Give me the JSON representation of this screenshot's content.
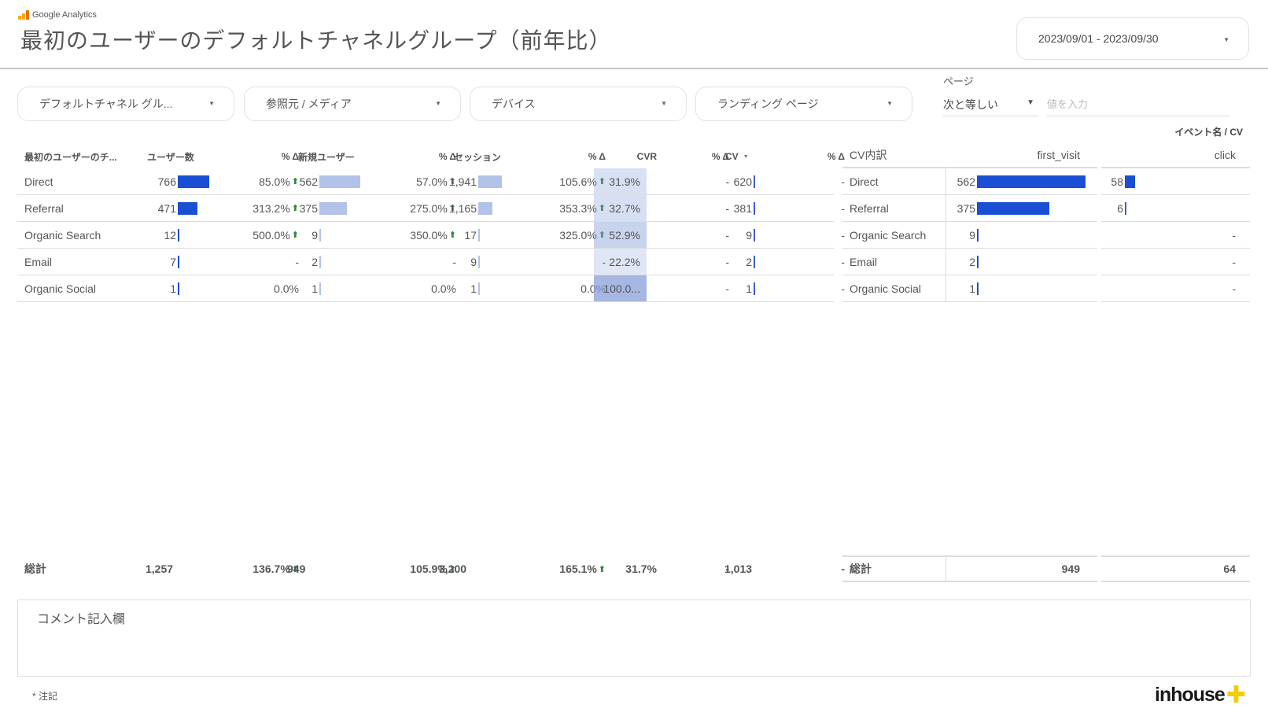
{
  "header": {
    "brand": "Google Analytics",
    "title": "最初のユーザーのデフォルトチャネルグループ（前年比）",
    "date_range": "2023/09/01 - 2023/09/30"
  },
  "filters": [
    {
      "label": "デフォルトチャネル グル..."
    },
    {
      "label": "参照元 / メディア"
    },
    {
      "label": "デバイス"
    },
    {
      "label": "ランディング ページ"
    }
  ],
  "page_filter": {
    "label": "ページ",
    "operator": "次と等しい",
    "placeholder": "値を入力",
    "value": ""
  },
  "colors": {
    "bar_dark": "#1a4fd4",
    "bar_light": "#b3c2e8",
    "up_arrow": "#2e8b3d",
    "brand_plus": "#f5cc00"
  },
  "main_table": {
    "headers": [
      "最初のユーザーのチ...",
      "ユーザー数",
      "% Δ",
      "新規ユーザー",
      "% Δ",
      "セッション",
      "% Δ",
      "CVR",
      "% Δ",
      "CV",
      "% Δ"
    ],
    "rows": [
      {
        "channel": "Direct",
        "users": "766",
        "users_bar": 1.0,
        "users_delta": "85.0%",
        "users_up": true,
        "new_users": "562",
        "new_users_bar": 1.0,
        "new_users_delta": "57.0%",
        "new_users_up": true,
        "sessions": "1,941",
        "sessions_bar": 1.0,
        "sessions_delta": "105.6%",
        "sessions_up": true,
        "cvr": "31.9%",
        "cvr_value": 0.319,
        "cvr_delta": "-",
        "cv": "620",
        "cv_delta": "-"
      },
      {
        "channel": "Referral",
        "users": "471",
        "users_bar": 0.615,
        "users_delta": "313.2%",
        "users_up": true,
        "new_users": "375",
        "new_users_bar": 0.667,
        "new_users_delta": "275.0%",
        "new_users_up": true,
        "sessions": "1,165",
        "sessions_bar": 0.6,
        "sessions_delta": "353.3%",
        "sessions_up": true,
        "cvr": "32.7%",
        "cvr_value": 0.327,
        "cvr_delta": "-",
        "cv": "381",
        "cv_delta": "-"
      },
      {
        "channel": "Organic Search",
        "users": "12",
        "users_bar": 0.016,
        "users_delta": "500.0%",
        "users_up": true,
        "new_users": "9",
        "new_users_bar": 0.016,
        "new_users_delta": "350.0%",
        "new_users_up": true,
        "sessions": "17",
        "sessions_bar": 0.009,
        "sessions_delta": "325.0%",
        "sessions_up": true,
        "cvr": "52.9%",
        "cvr_value": 0.529,
        "cvr_delta": "-",
        "cv": "9",
        "cv_delta": "-"
      },
      {
        "channel": "Email",
        "users": "7",
        "users_bar": 0.009,
        "users_delta": "-",
        "users_up": false,
        "new_users": "2",
        "new_users_bar": 0.004,
        "new_users_delta": "-",
        "new_users_up": false,
        "sessions": "9",
        "sessions_bar": 0.005,
        "sessions_delta": "-",
        "sessions_up": false,
        "cvr": "22.2%",
        "cvr_value": 0.222,
        "cvr_delta": "-",
        "cv": "2",
        "cv_delta": "-"
      },
      {
        "channel": "Organic Social",
        "users": "1",
        "users_bar": 0.001,
        "users_delta": "0.0%",
        "users_up": false,
        "new_users": "1",
        "new_users_bar": 0.002,
        "new_users_delta": "0.0%",
        "new_users_up": false,
        "sessions": "1",
        "sessions_bar": 0.001,
        "sessions_delta": "0.0%",
        "sessions_up": false,
        "cvr": "100.0...",
        "cvr_value": 1.0,
        "cvr_delta": "-",
        "cv": "1",
        "cv_delta": "-"
      }
    ],
    "totals": {
      "label": "総計",
      "users": "1,257",
      "users_delta": "136.7%",
      "new_users": "949",
      "new_users_delta": "105.9%",
      "sessions": "3,200",
      "sessions_delta": "165.1%",
      "cvr": "31.7%",
      "cvr_delta": "-",
      "cv": "1,013",
      "cv_delta": "-"
    }
  },
  "cv_table": {
    "caption": "イベント名 / CV",
    "headers": [
      "CV内訳",
      "first_visit",
      "click"
    ],
    "rows": [
      {
        "channel": "Direct",
        "first_visit": "562",
        "first_visit_bar": 1.0,
        "click": "58",
        "click_bar": 1.0
      },
      {
        "channel": "Referral",
        "first_visit": "375",
        "first_visit_bar": 0.667,
        "click": "6",
        "click_bar": 0.1
      },
      {
        "channel": "Organic Search",
        "first_visit": "9",
        "first_visit_bar": 0.016,
        "click": "-",
        "click_bar": 0
      },
      {
        "channel": "Email",
        "first_visit": "2",
        "first_visit_bar": 0.004,
        "click": "-",
        "click_bar": 0
      },
      {
        "channel": "Organic Social",
        "first_visit": "1",
        "first_visit_bar": 0.002,
        "click": "-",
        "click_bar": 0
      }
    ],
    "totals": {
      "label": "総計",
      "first_visit": "949",
      "click": "64"
    }
  },
  "comment": {
    "label": "コメント記入欄"
  },
  "footnote": "* 注記",
  "footer_brand": "inhouse",
  "footer_brand_mark": "✚"
}
